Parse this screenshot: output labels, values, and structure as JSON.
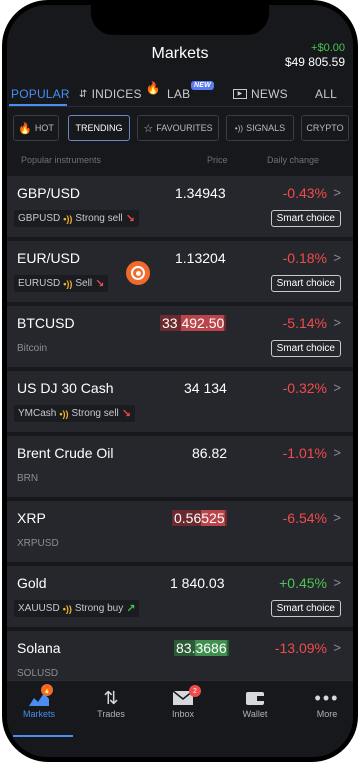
{
  "header": {
    "title": "Markets",
    "pl_delta": "+$0.00",
    "balance": "$49 805.59"
  },
  "tabs": [
    {
      "label": "POPULAR"
    },
    {
      "label": "INDICES"
    },
    {
      "label": "LAB",
      "badge": "NEW"
    },
    {
      "label": "NEWS"
    },
    {
      "label": "ALL"
    }
  ],
  "chips": [
    {
      "label": "HOT"
    },
    {
      "label": "TRENDING"
    },
    {
      "label": "FAVOURITES"
    },
    {
      "label": "SIGNALS"
    },
    {
      "label": "CRYPTO"
    }
  ],
  "columns": {
    "instrument": "Popular instruments",
    "price": "Price",
    "change": "Daily change"
  },
  "rows": [
    {
      "name": "GBP/USD",
      "price": "1.34943",
      "change": "-0.43%",
      "direction": "negative",
      "symbol": "GBPUSD",
      "signal": "Strong sell",
      "signal_dir": "down",
      "smart": "Smart choice"
    },
    {
      "name": "EUR/USD",
      "price": "1.13204",
      "change": "-0.18%",
      "direction": "negative",
      "symbol": "EURUSD",
      "signal": "Sell",
      "signal_dir": "down",
      "smart": "Smart choice"
    },
    {
      "name": "BTCUSD",
      "price_head": "33 ",
      "price_tail": "492.50",
      "change": "-5.14%",
      "direction": "negative",
      "subtitle": "Bitcoin",
      "smart": "Smart choice",
      "highlight": "red"
    },
    {
      "name": "US DJ 30 Cash",
      "price": "34 134",
      "change": "-0.32%",
      "direction": "negative",
      "symbol": "YMCash",
      "signal": "Strong sell",
      "signal_dir": "down"
    },
    {
      "name": "Brent Crude Oil",
      "price": "86.82",
      "change": "-1.01%",
      "direction": "negative",
      "subtitle": "BRN"
    },
    {
      "name": "XRP",
      "price_head": "0.56",
      "price_tail": "525",
      "change": "-6.54%",
      "direction": "negative",
      "subtitle": "XRPUSD",
      "highlight": "red"
    },
    {
      "name": "Gold",
      "price": "1 840.03",
      "change": "+0.45%",
      "direction": "positive",
      "symbol": "XAUUSD",
      "signal": "Strong buy",
      "signal_dir": "up",
      "smart": "Smart choice"
    },
    {
      "name": "Solana",
      "price_head": "83.",
      "price_tail": "3686",
      "change": "-13.09%",
      "direction": "negative",
      "subtitle": "SOLUSD",
      "highlight": "green"
    }
  ],
  "nav": [
    {
      "label": "Markets"
    },
    {
      "label": "Trades"
    },
    {
      "label": "Inbox",
      "badge": "2"
    },
    {
      "label": "Wallet"
    },
    {
      "label": "More"
    }
  ],
  "icons": {
    "signal": "signal-waves-icon",
    "chevron": "chevron-right-icon",
    "arrow_down": "arrow-down-right-icon",
    "arrow_up": "arrow-up-right-icon"
  },
  "colors": {
    "accent": "#4a8df0",
    "negative": "#f24b4b",
    "positive": "#4cc552",
    "hot": "#f26a2b"
  }
}
